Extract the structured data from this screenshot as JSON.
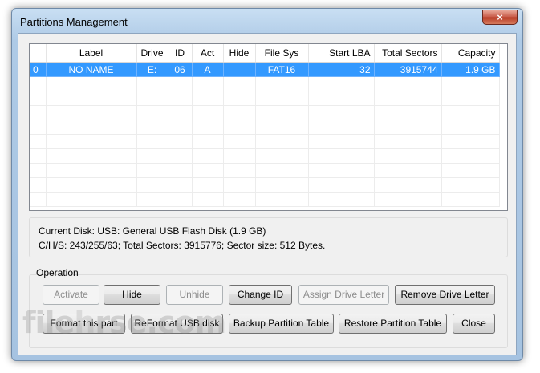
{
  "window": {
    "title": "Partitions Management",
    "close_glyph": "×"
  },
  "table": {
    "columns": [
      "",
      "Label",
      "Drive",
      "ID",
      "Act",
      "Hide",
      "File Sys",
      "Start LBA",
      "Total Sectors",
      "Capacity"
    ],
    "rows": [
      [
        "0",
        "NO NAME",
        "E:",
        "06",
        "A",
        "",
        "FAT16",
        "32",
        "3915744",
        "1.9 GB"
      ]
    ]
  },
  "disk_info": {
    "line1": "Current Disk:   USB: General USB Flash Disk (1.9 GB)",
    "line2": "C/H/S: 243/255/63; Total Sectors: 3915776; Sector size: 512 Bytes."
  },
  "operation": {
    "label": "Operation",
    "buttons": {
      "activate": "Activate",
      "hide": "Hide",
      "unhide": "Unhide",
      "change_id": "Change ID",
      "assign_drive_letter": "Assign Drive Letter",
      "remove_drive_letter": "Remove Drive Letter",
      "format_part": "Format this part",
      "reformat_usb": "ReFormat USB disk",
      "backup_table": "Backup Partition Table",
      "restore_table": "Restore Partition Table",
      "close": "Close"
    }
  },
  "watermark": {
    "left": "file",
    "mid": "h",
    "right": "rse.com"
  }
}
